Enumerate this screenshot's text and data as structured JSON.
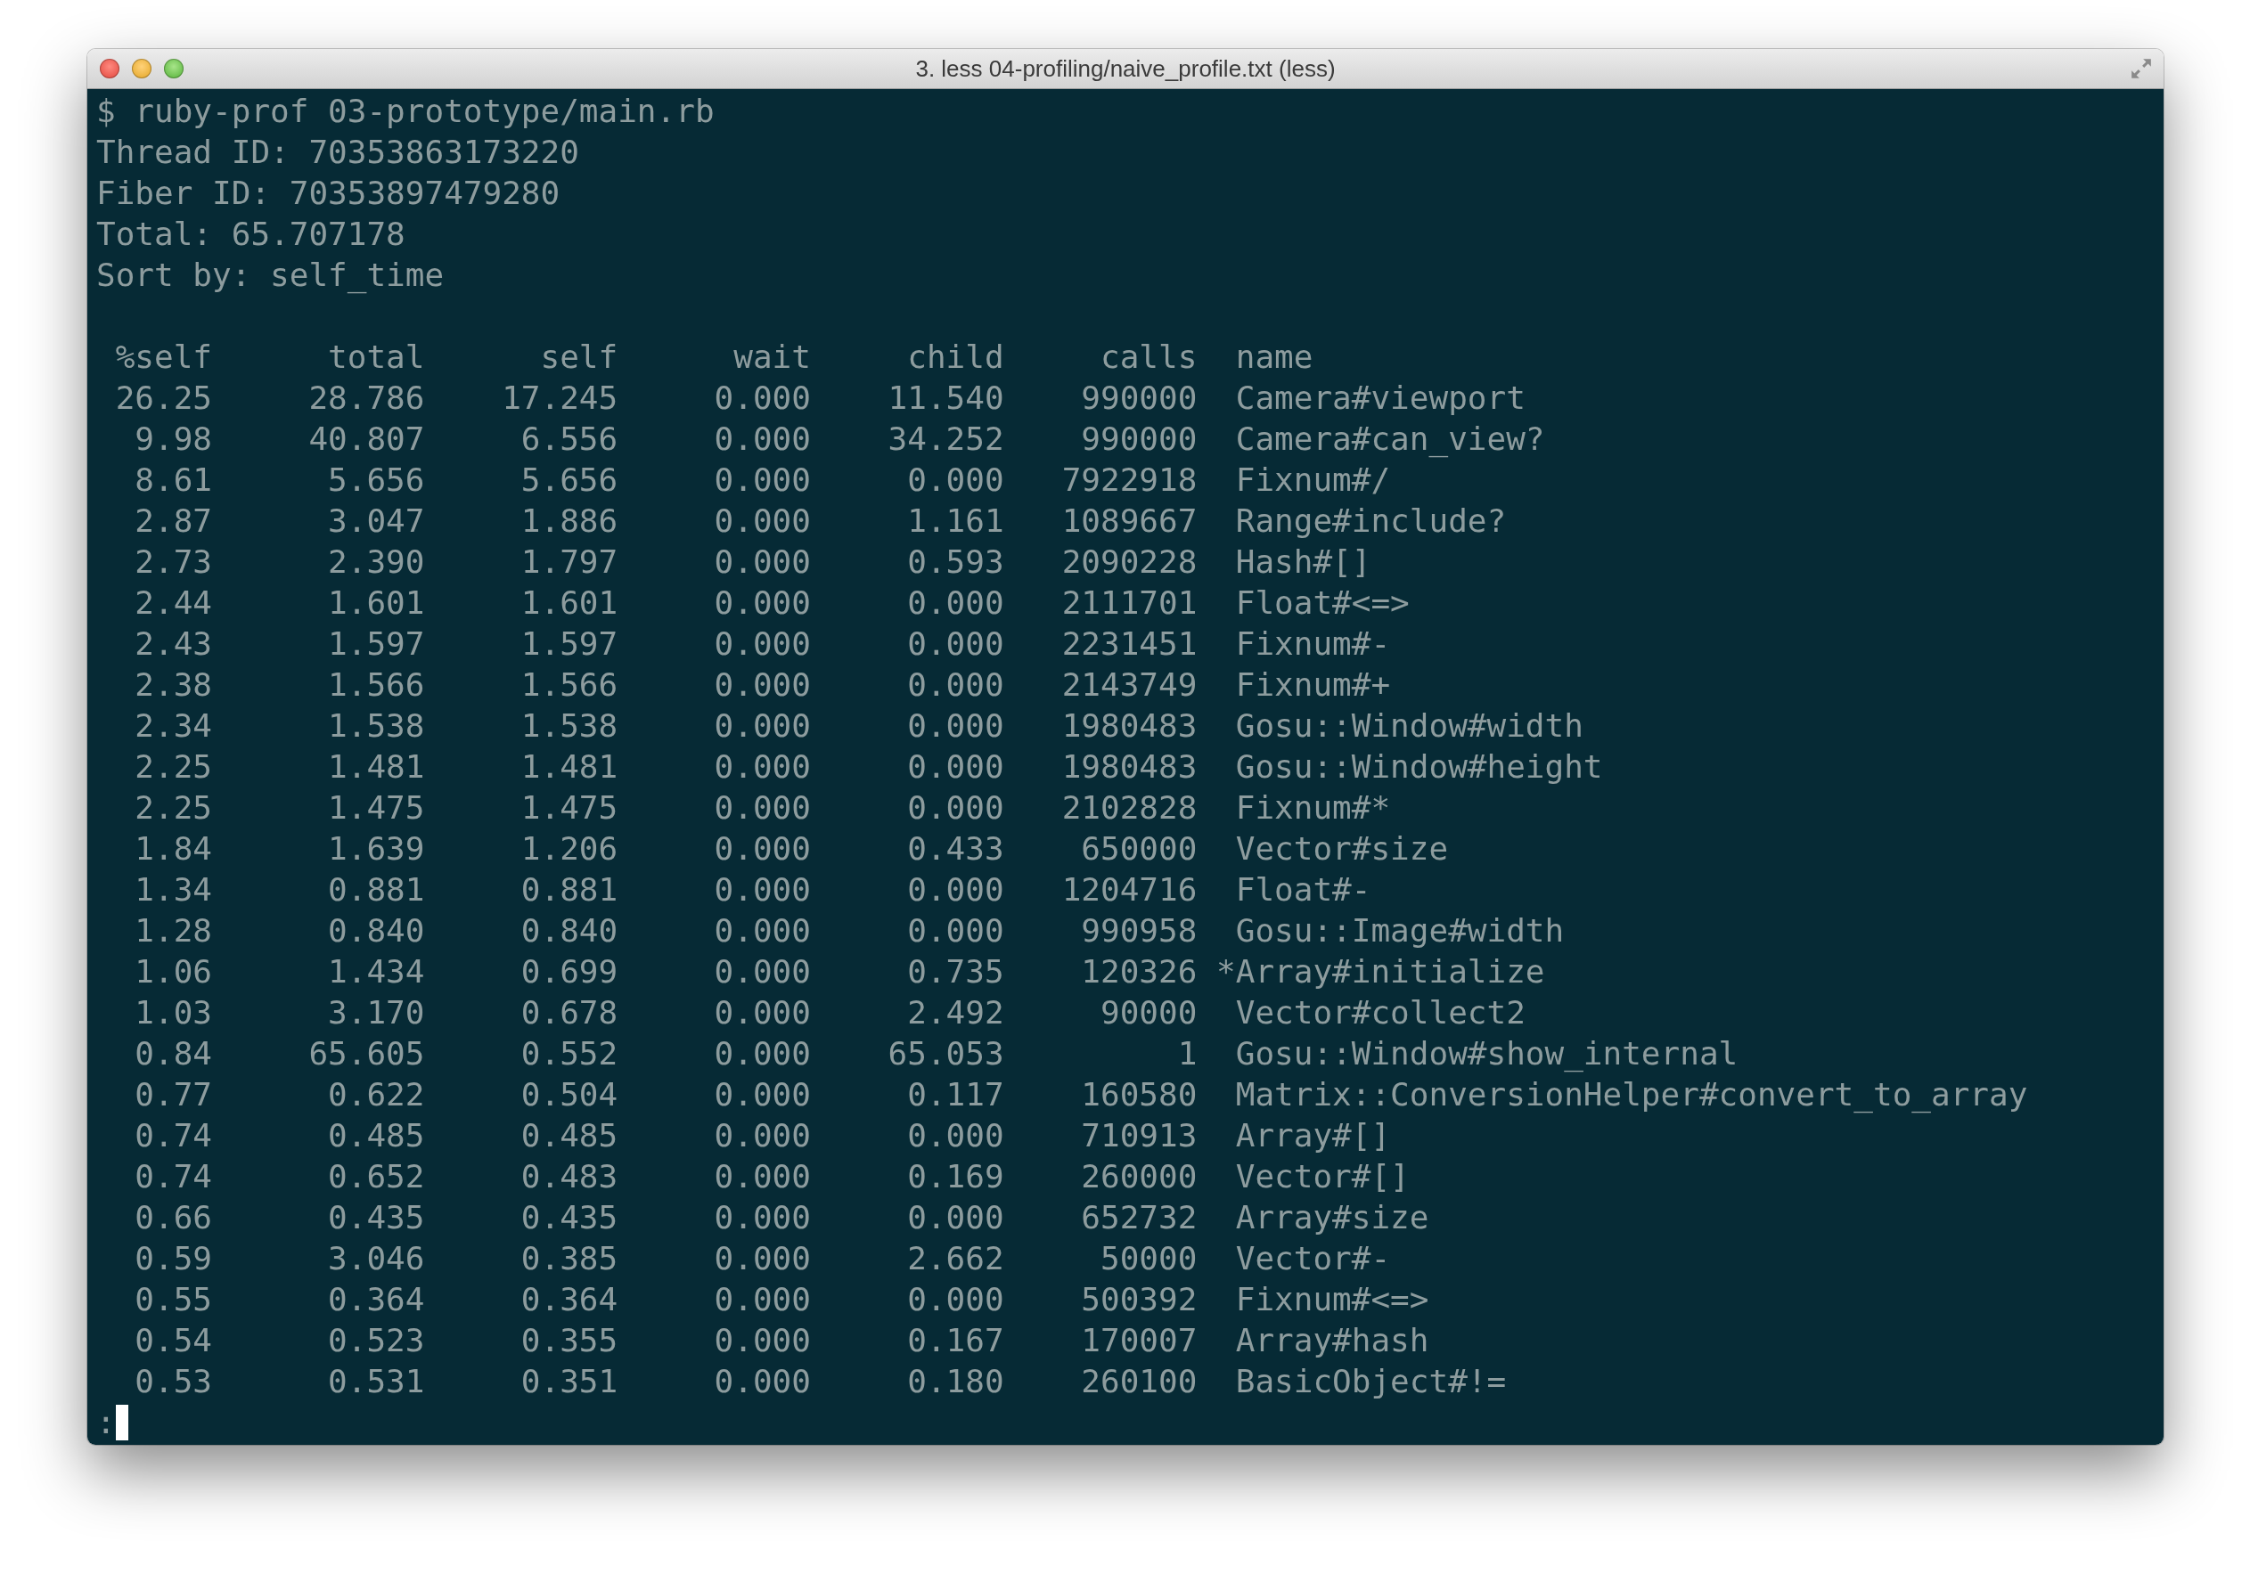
{
  "window": {
    "title": "3. less 04-profiling/naive_profile.txt (less)"
  },
  "terminal": {
    "lines": [
      "$ ruby-prof 03-prototype/main.rb",
      "Thread ID: 70353863173220",
      "Fiber ID: 70353897479280",
      "Total: 65.707178",
      "Sort by: self_time"
    ],
    "table": {
      "columns": [
        "%self",
        "total",
        "self",
        "wait",
        "child",
        "calls",
        "name"
      ],
      "rows": [
        {
          "cells": [
            "26.25",
            "28.786",
            "17.245",
            "0.000",
            "11.540",
            "990000"
          ],
          "name": "Camera#viewport",
          "recursive": false
        },
        {
          "cells": [
            "9.98",
            "40.807",
            "6.556",
            "0.000",
            "34.252",
            "990000"
          ],
          "name": "Camera#can_view?",
          "recursive": false
        },
        {
          "cells": [
            "8.61",
            "5.656",
            "5.656",
            "0.000",
            "0.000",
            "7922918"
          ],
          "name": "Fixnum#/",
          "recursive": false
        },
        {
          "cells": [
            "2.87",
            "3.047",
            "1.886",
            "0.000",
            "1.161",
            "1089667"
          ],
          "name": "Range#include?",
          "recursive": false
        },
        {
          "cells": [
            "2.73",
            "2.390",
            "1.797",
            "0.000",
            "0.593",
            "2090228"
          ],
          "name": "Hash#[]",
          "recursive": false
        },
        {
          "cells": [
            "2.44",
            "1.601",
            "1.601",
            "0.000",
            "0.000",
            "2111701"
          ],
          "name": "Float#<=>",
          "recursive": false
        },
        {
          "cells": [
            "2.43",
            "1.597",
            "1.597",
            "0.000",
            "0.000",
            "2231451"
          ],
          "name": "Fixnum#-",
          "recursive": false
        },
        {
          "cells": [
            "2.38",
            "1.566",
            "1.566",
            "0.000",
            "0.000",
            "2143749"
          ],
          "name": "Fixnum#+",
          "recursive": false
        },
        {
          "cells": [
            "2.34",
            "1.538",
            "1.538",
            "0.000",
            "0.000",
            "1980483"
          ],
          "name": "Gosu::Window#width",
          "recursive": false
        },
        {
          "cells": [
            "2.25",
            "1.481",
            "1.481",
            "0.000",
            "0.000",
            "1980483"
          ],
          "name": "Gosu::Window#height",
          "recursive": false
        },
        {
          "cells": [
            "2.25",
            "1.475",
            "1.475",
            "0.000",
            "0.000",
            "2102828"
          ],
          "name": "Fixnum#*",
          "recursive": false
        },
        {
          "cells": [
            "1.84",
            "1.639",
            "1.206",
            "0.000",
            "0.433",
            "650000"
          ],
          "name": "Vector#size",
          "recursive": false
        },
        {
          "cells": [
            "1.34",
            "0.881",
            "0.881",
            "0.000",
            "0.000",
            "1204716"
          ],
          "name": "Float#-",
          "recursive": false
        },
        {
          "cells": [
            "1.28",
            "0.840",
            "0.840",
            "0.000",
            "0.000",
            "990958"
          ],
          "name": "Gosu::Image#width",
          "recursive": false
        },
        {
          "cells": [
            "1.06",
            "1.434",
            "0.699",
            "0.000",
            "0.735",
            "120326"
          ],
          "name": "*Array#initialize",
          "recursive": true
        },
        {
          "cells": [
            "1.03",
            "3.170",
            "0.678",
            "0.000",
            "2.492",
            "90000"
          ],
          "name": "Vector#collect2",
          "recursive": false
        },
        {
          "cells": [
            "0.84",
            "65.605",
            "0.552",
            "0.000",
            "65.053",
            "1"
          ],
          "name": "Gosu::Window#show_internal",
          "recursive": false
        },
        {
          "cells": [
            "0.77",
            "0.622",
            "0.504",
            "0.000",
            "0.117",
            "160580"
          ],
          "name": "Matrix::ConversionHelper#convert_to_array",
          "recursive": false
        },
        {
          "cells": [
            "0.74",
            "0.485",
            "0.485",
            "0.000",
            "0.000",
            "710913"
          ],
          "name": "Array#[]",
          "recursive": false
        },
        {
          "cells": [
            "0.74",
            "0.652",
            "0.483",
            "0.000",
            "0.169",
            "260000"
          ],
          "name": "Vector#[]",
          "recursive": false
        },
        {
          "cells": [
            "0.66",
            "0.435",
            "0.435",
            "0.000",
            "0.000",
            "652732"
          ],
          "name": "Array#size",
          "recursive": false
        },
        {
          "cells": [
            "0.59",
            "3.046",
            "0.385",
            "0.000",
            "2.662",
            "50000"
          ],
          "name": "Vector#-",
          "recursive": false
        },
        {
          "cells": [
            "0.55",
            "0.364",
            "0.364",
            "0.000",
            "0.000",
            "500392"
          ],
          "name": "Fixnum#<=>",
          "recursive": false
        },
        {
          "cells": [
            "0.54",
            "0.523",
            "0.355",
            "0.000",
            "0.167",
            "170007"
          ],
          "name": "Array#hash",
          "recursive": false
        },
        {
          "cells": [
            "0.53",
            "0.531",
            "0.351",
            "0.000",
            "0.180",
            "260100"
          ],
          "name": "BasicObject#!=",
          "recursive": false
        }
      ]
    },
    "prompt": ":"
  }
}
